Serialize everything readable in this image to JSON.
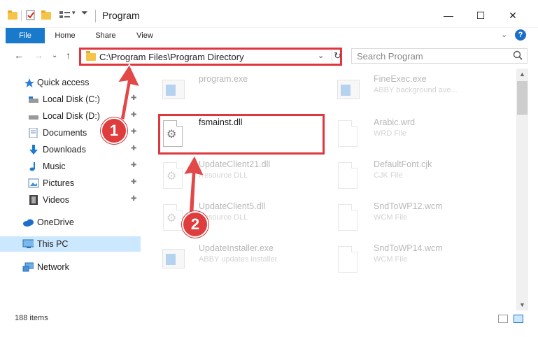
{
  "window": {
    "title": "Program",
    "minimize_glyph": "—",
    "maximize_glyph": "☐",
    "close_glyph": "✕"
  },
  "ribbon": {
    "tabs": [
      "File",
      "Home",
      "Share",
      "View"
    ],
    "expand_glyph": "⌄",
    "help_glyph": "?"
  },
  "address": {
    "path": "C:\\Program Files\\Program Directory",
    "dropdown_glyph": "⌄",
    "refresh_glyph": "↻"
  },
  "search": {
    "placeholder": "Search Program",
    "icon": "search-icon"
  },
  "navigation": {
    "back_glyph": "←",
    "forward_glyph": "→",
    "recent_glyph": "⌄",
    "up_glyph": "↑"
  },
  "sidebar": {
    "quick_access": "Quick access",
    "items": [
      {
        "label": "Local Disk (C:)",
        "icon": "drive-icon",
        "pinned": true
      },
      {
        "label": "Local Disk (D:)",
        "icon": "drive-icon",
        "pinned": true
      },
      {
        "label": "Documents",
        "icon": "documents-icon",
        "pinned": true
      },
      {
        "label": "Downloads",
        "icon": "downloads-icon",
        "pinned": true
      },
      {
        "label": "Music",
        "icon": "music-icon",
        "pinned": true
      },
      {
        "label": "Pictures",
        "icon": "pictures-icon",
        "pinned": true
      },
      {
        "label": "Videos",
        "icon": "videos-icon",
        "pinned": true
      }
    ],
    "onedrive": "OneDrive",
    "this_pc": "This PC",
    "network": "Network",
    "pin_glyph": "📌"
  },
  "files": [
    {
      "name": "program.exe",
      "desc": "",
      "type": "exe",
      "faded": true
    },
    {
      "name": "FineExec.exe",
      "desc": "ABBY background ave...",
      "type": "exe",
      "faded": true
    },
    {
      "name": "fsmainst.dll",
      "desc": "",
      "type": "dll",
      "faded": false
    },
    {
      "name": "Arabic.wrd",
      "desc": "WRD File",
      "type": "doc",
      "faded": true
    },
    {
      "name": "UpdateClient21.dll",
      "desc": "Resource DLL",
      "type": "dll",
      "faded": true
    },
    {
      "name": "DefaultFont.cjk",
      "desc": "CJK File",
      "type": "doc",
      "faded": true
    },
    {
      "name": "UpdateClient5.dll",
      "desc": "Resource DLL",
      "type": "dll",
      "faded": true
    },
    {
      "name": "SndToWP12.wcm",
      "desc": "WCM File",
      "type": "doc",
      "faded": true
    },
    {
      "name": "UpdateInstaller.exe",
      "desc": "ABBY updates installer",
      "type": "exe",
      "faded": true
    },
    {
      "name": "SndToWP14.wcm",
      "desc": "WCM File",
      "type": "doc",
      "faded": true
    }
  ],
  "status": {
    "item_count": "188 items"
  },
  "callouts": [
    "1",
    "2"
  ],
  "colors": {
    "accent": "#1979ca",
    "highlight": "#e0373f",
    "selected": "#cce8ff"
  }
}
